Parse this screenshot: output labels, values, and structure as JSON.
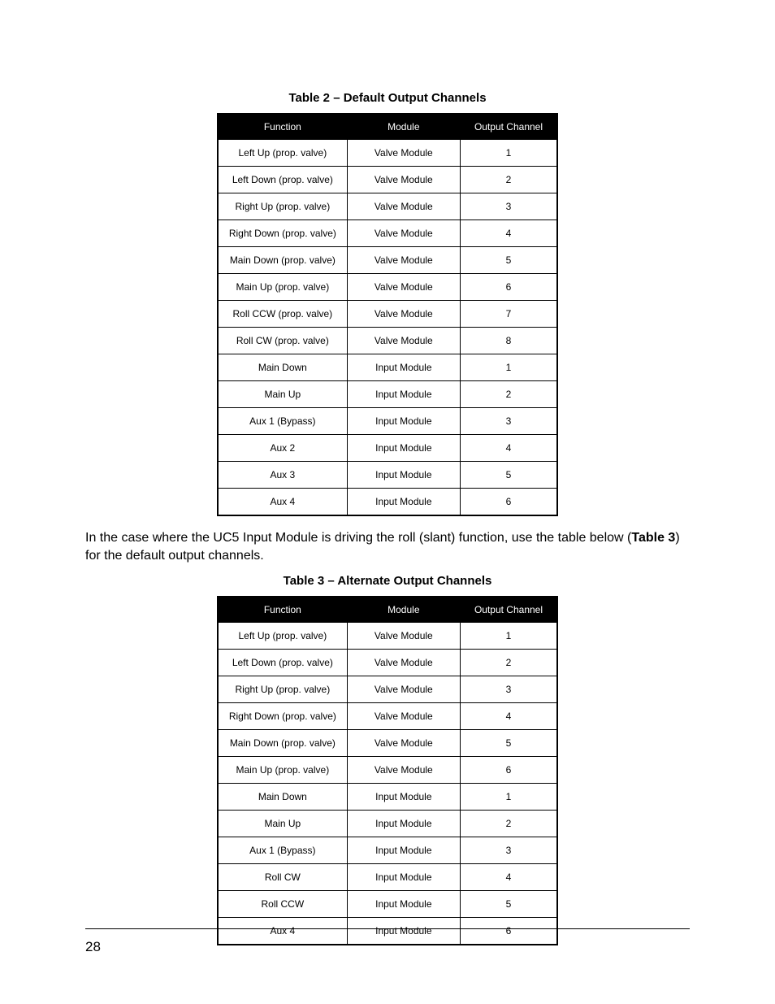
{
  "table2": {
    "caption": "Table 2 – Default Output Channels",
    "headers": [
      "Function",
      "Module",
      "Output Channel"
    ],
    "rows": [
      [
        "Left Up (prop. valve)",
        "Valve Module",
        "1"
      ],
      [
        "Left Down (prop. valve)",
        "Valve Module",
        "2"
      ],
      [
        "Right Up (prop. valve)",
        "Valve Module",
        "3"
      ],
      [
        "Right Down (prop. valve)",
        "Valve Module",
        "4"
      ],
      [
        "Main Down (prop. valve)",
        "Valve Module",
        "5"
      ],
      [
        "Main Up (prop. valve)",
        "Valve Module",
        "6"
      ],
      [
        "Roll CCW (prop. valve)",
        "Valve Module",
        "7"
      ],
      [
        "Roll CW (prop. valve)",
        "Valve Module",
        "8"
      ],
      [
        "Main Down",
        "Input Module",
        "1"
      ],
      [
        "Main Up",
        "Input Module",
        "2"
      ],
      [
        "Aux 1 (Bypass)",
        "Input Module",
        "3"
      ],
      [
        "Aux 2",
        "Input Module",
        "4"
      ],
      [
        "Aux 3",
        "Input Module",
        "5"
      ],
      [
        "Aux 4",
        "Input Module",
        "6"
      ]
    ]
  },
  "body_paragraph": {
    "pre": "In the case where the UC5 Input Module is driving the roll (slant) function, use the table below (",
    "bold": "Table 3",
    "post": ") for the default output channels."
  },
  "table3": {
    "caption": "Table 3 – Alternate Output Channels",
    "headers": [
      "Function",
      "Module",
      "Output Channel"
    ],
    "rows": [
      [
        "Left Up (prop. valve)",
        "Valve Module",
        "1"
      ],
      [
        "Left Down (prop. valve)",
        "Valve Module",
        "2"
      ],
      [
        "Right Up (prop. valve)",
        "Valve Module",
        "3"
      ],
      [
        "Right Down (prop. valve)",
        "Valve Module",
        "4"
      ],
      [
        "Main Down (prop. valve)",
        "Valve Module",
        "5"
      ],
      [
        "Main Up (prop. valve)",
        "Valve Module",
        "6"
      ],
      [
        "Main Down",
        "Input Module",
        "1"
      ],
      [
        "Main Up",
        "Input Module",
        "2"
      ],
      [
        "Aux 1 (Bypass)",
        "Input Module",
        "3"
      ],
      [
        "Roll CW",
        "Input Module",
        "4"
      ],
      [
        "Roll CCW",
        "Input Module",
        "5"
      ],
      [
        "Aux 4",
        "Input Module",
        "6"
      ]
    ]
  },
  "page_number": "28"
}
